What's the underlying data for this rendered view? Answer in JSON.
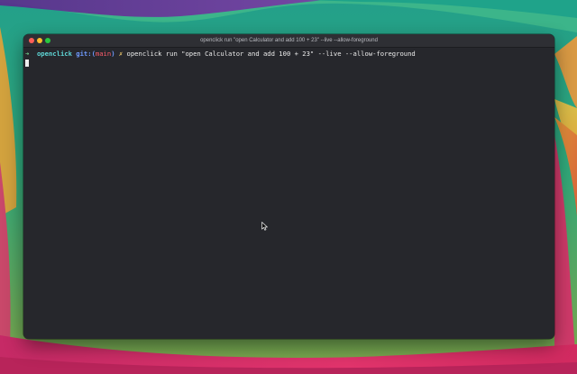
{
  "window": {
    "title": "openclick run \"open Calculator and add 100 + 23\" --live --allow-foreground"
  },
  "terminal": {
    "prompt_symbol": "➜",
    "directory": "openclick",
    "git_label": "git:",
    "git_open": "(",
    "branch": "main",
    "git_close": ")",
    "dirty_marker": "✗",
    "command": "openclick run \"open Calculator and add 100 + 23\" --live --allow-foreground"
  },
  "colors": {
    "terminal_background": "#26272c",
    "close": "#ff5f57",
    "minimize": "#febc2e",
    "zoom": "#28c840"
  },
  "icons": {
    "cursor": "text-block-cursor",
    "pointer": "arrow-pointer-icon"
  }
}
